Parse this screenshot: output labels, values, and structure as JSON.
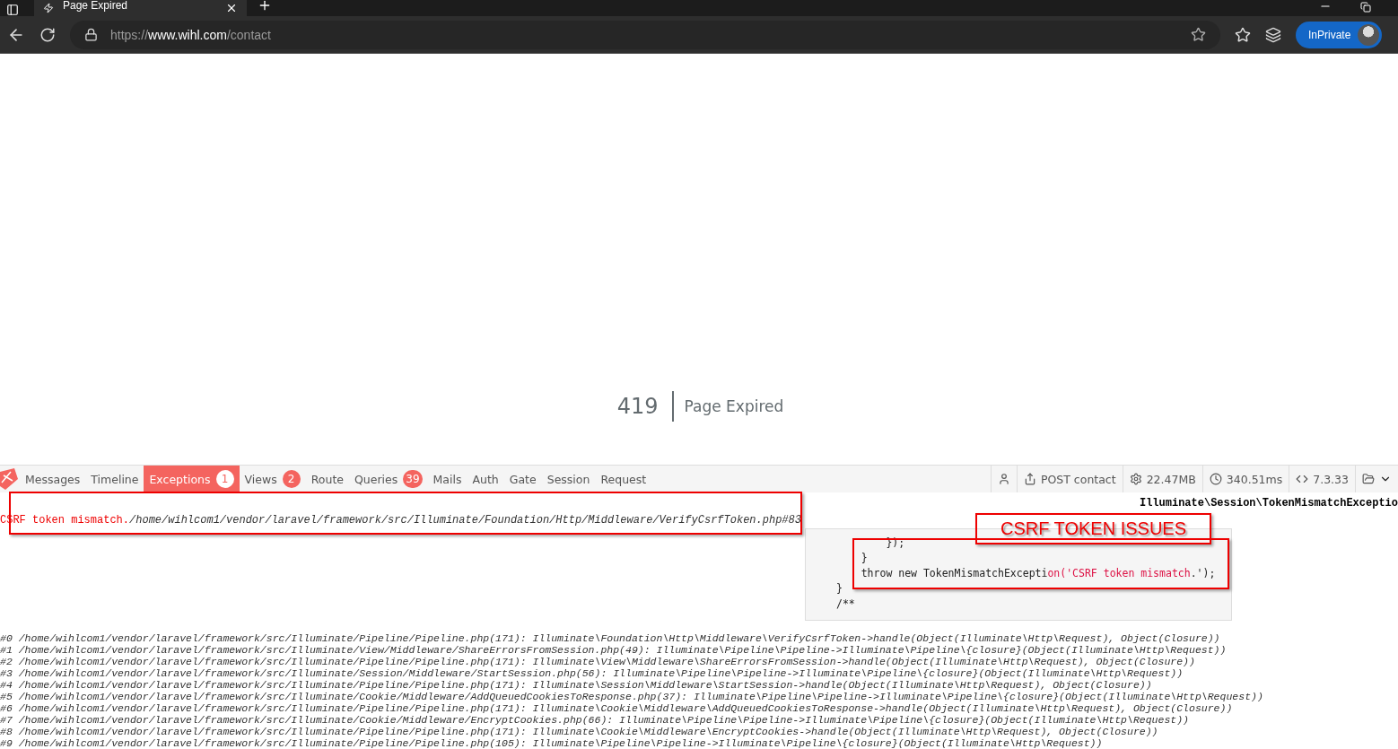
{
  "browser": {
    "tab": {
      "title": "Page Expired",
      "selected": true
    },
    "url": {
      "scheme": "https://",
      "host": "www.wihl.com",
      "path": "/contact"
    },
    "profile_label": "InPrivate"
  },
  "page": {
    "status_code": "419",
    "message": "Page Expired"
  },
  "debugbar": {
    "tabs": [
      {
        "label": "Messages",
        "selected": false
      },
      {
        "label": "Timeline",
        "selected": false
      },
      {
        "label": "Exceptions",
        "badge": "1",
        "selected": true
      },
      {
        "label": "Views",
        "badge": "2",
        "selected": false
      },
      {
        "label": "Route",
        "selected": false
      },
      {
        "label": "Queries",
        "badge": "39",
        "selected": false
      },
      {
        "label": "Mails",
        "selected": false
      },
      {
        "label": "Auth",
        "selected": false
      },
      {
        "label": "Gate",
        "selected": false
      },
      {
        "label": "Session",
        "selected": false
      },
      {
        "label": "Request",
        "selected": false
      }
    ],
    "indicators": [
      {
        "kind": "user"
      },
      {
        "kind": "route",
        "text": "POST contact"
      },
      {
        "kind": "memory",
        "text": "22.47MB"
      },
      {
        "kind": "time",
        "text": "340.51ms"
      },
      {
        "kind": "version",
        "text": "7.3.33"
      },
      {
        "kind": "open"
      }
    ]
  },
  "exception": {
    "class": "Illuminate\\Session\\TokenMismatchExceptio",
    "message": "CSRF token mismatch.",
    "file": "/home/wihlcom1/vendor/laravel/framework/src/Illuminate/Foundation/Http/Middleware/VerifyCsrfToken.php#83",
    "code_lines": [
      {
        "segments": [
          {
            "kind": "plain",
            "text": "        });"
          }
        ]
      },
      {
        "segments": [
          {
            "kind": "plain",
            "text": "    }"
          }
        ]
      },
      {
        "segments": [
          {
            "kind": "plain",
            "text": "    throw new TokenMismatchExcepti"
          },
          {
            "kind": "string",
            "text": "on('CSRF token mismatch"
          },
          {
            "kind": "plain",
            "text": ".');"
          }
        ]
      },
      {
        "segments": [
          {
            "kind": "plain",
            "text": "}"
          }
        ]
      },
      {
        "segments": [
          {
            "kind": "plain",
            "text": "/**"
          }
        ]
      }
    ],
    "trace": [
      "#0 /home/wihlcom1/vendor/laravel/framework/src/Illuminate/Pipeline/Pipeline.php(171): Illuminate\\Foundation\\Http\\Middleware\\VerifyCsrfToken->handle(Object(Illuminate\\Http\\Request), Object(Closure))",
      "#1 /home/wihlcom1/vendor/laravel/framework/src/Illuminate/View/Middleware/ShareErrorsFromSession.php(49): Illuminate\\Pipeline\\Pipeline->Illuminate\\Pipeline\\{closure}(Object(Illuminate\\Http\\Request))",
      "#2 /home/wihlcom1/vendor/laravel/framework/src/Illuminate/Pipeline/Pipeline.php(171): Illuminate\\View\\Middleware\\ShareErrorsFromSession->handle(Object(Illuminate\\Http\\Request), Object(Closure))",
      "#3 /home/wihlcom1/vendor/laravel/framework/src/Illuminate/Session/Middleware/StartSession.php(56): Illuminate\\Pipeline\\Pipeline->Illuminate\\Pipeline\\{closure}(Object(Illuminate\\Http\\Request))",
      "#4 /home/wihlcom1/vendor/laravel/framework/src/Illuminate/Pipeline/Pipeline.php(171): Illuminate\\Session\\Middleware\\StartSession->handle(Object(Illuminate\\Http\\Request), Object(Closure))",
      "#5 /home/wihlcom1/vendor/laravel/framework/src/Illuminate/Cookie/Middleware/AddQueuedCookiesToResponse.php(37): Illuminate\\Pipeline\\Pipeline->Illuminate\\Pipeline\\{closure}(Object(Illuminate\\Http\\Request))",
      "#6 /home/wihlcom1/vendor/laravel/framework/src/Illuminate/Pipeline/Pipeline.php(171): Illuminate\\Cookie\\Middleware\\AddQueuedCookiesToResponse->handle(Object(Illuminate\\Http\\Request), Object(Closure))",
      "#7 /home/wihlcom1/vendor/laravel/framework/src/Illuminate/Cookie/Middleware/EncryptCookies.php(66): Illuminate\\Pipeline\\Pipeline->Illuminate\\Pipeline\\{closure}(Object(Illuminate\\Http\\Request))",
      "#8 /home/wihlcom1/vendor/laravel/framework/src/Illuminate/Pipeline/Pipeline.php(171): Illuminate\\Cookie\\Middleware\\EncryptCookies->handle(Object(Illuminate\\Http\\Request), Object(Closure))",
      "#9 /home/wihlcom1/vendor/laravel/framework/src/Illuminate/Pipeline/Pipeline.php(105): Illuminate\\Pipeline\\Pipeline->Illuminate\\Pipeline\\{closure}(Object(Illuminate\\Http\\Request))"
    ]
  },
  "annotations": [
    {
      "kind": "messagebox"
    },
    {
      "kind": "label",
      "text": "CSRF TOKEN ISSUES"
    },
    {
      "kind": "codebox"
    }
  ]
}
